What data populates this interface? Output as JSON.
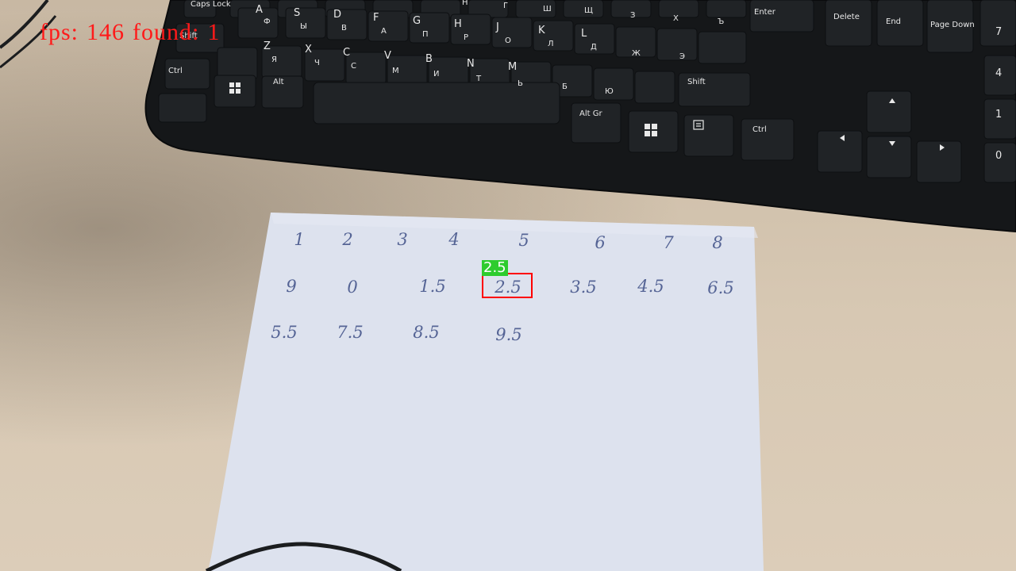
{
  "overlay": {
    "fps_label": "fps:",
    "fps_value": "146",
    "found_label": "found:",
    "found_value": "1"
  },
  "detection": {
    "label": "2.5",
    "box_color": "#ff0000",
    "label_bg": "#2ecc2e"
  },
  "paper": {
    "rows": [
      [
        "1",
        "2",
        "3",
        "4",
        "5",
        "6",
        "7",
        "8"
      ],
      [
        "9",
        "0",
        "1.5",
        "2.5",
        "3.5",
        "4.5",
        "6.5"
      ],
      [
        "5.5",
        "7.5",
        "8.5",
        "9.5"
      ]
    ]
  },
  "keyboard": {
    "keys": {
      "caps_lock": "Caps Lock",
      "shift_left": "Shift",
      "shift_right": "Shift",
      "ctrl_left": "Ctrl",
      "ctrl_right": "Ctrl",
      "alt": "Alt",
      "alt_gr": "Alt Gr",
      "enter": "Enter",
      "delete": "Delete",
      "end": "End",
      "page_down": "Page Down",
      "a": "A",
      "s": "S",
      "d": "D",
      "f": "F",
      "g": "G",
      "h": "H",
      "j": "J",
      "k": "K",
      "l": "L",
      "z": "Z",
      "x": "X",
      "c": "C",
      "v": "V",
      "b": "B",
      "n": "N",
      "m": "M",
      "cyr_f": "Ф",
      "cyr_y": "Ы",
      "cyr_v": "В",
      "cyr_a": "А",
      "cyr_p": "П",
      "cyr_r": "Р",
      "cyr_o": "О",
      "cyr_l": "Л",
      "cyr_d": "Д",
      "cyr_zh": "Ж",
      "cyr_e": "Э",
      "cyr_ya": "Я",
      "cyr_ch": "Ч",
      "cyr_s": "С",
      "cyr_m": "М",
      "cyr_i": "И",
      "cyr_t": "Т",
      "cyr_soft": "Ь",
      "cyr_b": "Б",
      "cyr_yu": "Ю",
      "cyr_n": "Н",
      "cyr_g": "Г",
      "cyr_sh": "Ш",
      "cyr_shch": "Щ",
      "cyr_z": "З",
      "cyr_kh": "Х",
      "cyr_hard": "Ъ",
      "num_7": "7",
      "num_4": "4",
      "num_1": "1",
      "num_0": "0"
    }
  }
}
